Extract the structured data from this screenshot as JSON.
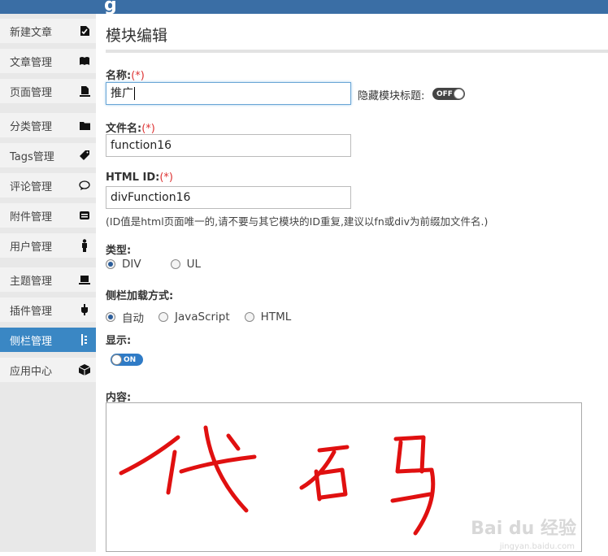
{
  "sidebar": {
    "items": [
      {
        "label": "新建文章",
        "icon": "new-doc-icon"
      },
      {
        "label": "文章管理",
        "icon": "book-icon"
      },
      {
        "label": "页面管理",
        "icon": "page-icon"
      },
      {
        "label": "分类管理",
        "icon": "folder-icon"
      },
      {
        "label": "Tags管理",
        "icon": "tag-icon"
      },
      {
        "label": "评论管理",
        "icon": "comment-icon"
      },
      {
        "label": "附件管理",
        "icon": "attachment-icon"
      },
      {
        "label": "用户管理",
        "icon": "user-icon"
      },
      {
        "label": "主题管理",
        "icon": "theme-icon"
      },
      {
        "label": "插件管理",
        "icon": "plugin-icon"
      },
      {
        "label": "侧栏管理",
        "icon": "sidebar-icon",
        "active": true
      },
      {
        "label": "应用中心",
        "icon": "app-center-icon"
      }
    ]
  },
  "page": {
    "title": "模块编辑"
  },
  "form": {
    "name_label": "名称:",
    "required_mark": "(*)",
    "name_value": "推广",
    "hide_title_label": "隐藏模块标题:",
    "hide_title_toggle": "OFF",
    "filename_label": "文件名:",
    "filename_value": "function16",
    "htmlid_label": "HTML ID:",
    "htmlid_value": "divFunction16",
    "htmlid_hint": "(ID值是html页面唯一的,请不要与其它模块的ID重复,建议以fn或div为前缀加文件名.)",
    "type_label": "类型:",
    "type_options": [
      "DIV",
      "UL"
    ],
    "type_selected": "DIV",
    "load_label": "侧栏加载方式:",
    "load_options": [
      "自动",
      "JavaScript",
      "HTML"
    ],
    "load_selected": "自动",
    "show_label": "显示:",
    "show_toggle": "ON",
    "content_label": "内容:"
  },
  "watermark": {
    "text": "Bai du 经验",
    "sub": "jingyan.baidu.com"
  },
  "colors": {
    "accent": "#3a87c4",
    "topbar": "#3a6ea5",
    "handwriting": "#e01010",
    "required": "#dd3333"
  }
}
